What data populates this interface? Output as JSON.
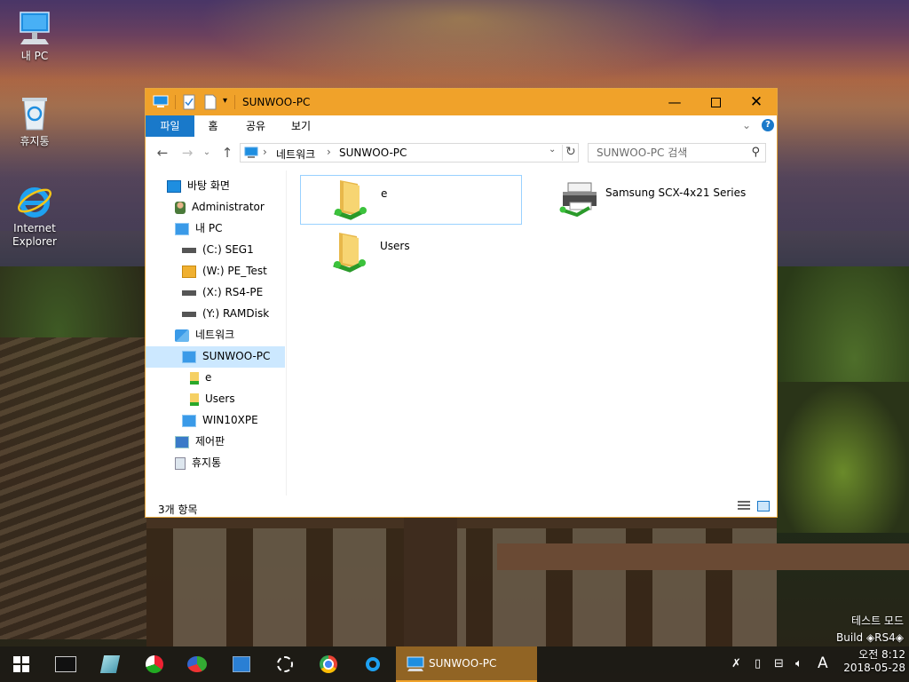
{
  "desktop": {
    "icons": [
      {
        "label": "내 PC"
      },
      {
        "label": "휴지통"
      },
      {
        "label": "Internet Explorer"
      }
    ],
    "watermark": {
      "line1": "테스트 모드",
      "line2": "Build  ◈RS4◈"
    }
  },
  "explorer": {
    "title": "SUNWOO-PC",
    "ribbon_tabs": [
      "파일",
      "홈",
      "공유",
      "보기"
    ],
    "address": {
      "segments": [
        "네트워크",
        "SUNWOO-PC"
      ]
    },
    "search_placeholder": "SUNWOO-PC 검색",
    "nav": [
      {
        "label": "바탕 화면",
        "icon": "desktop-icon"
      },
      {
        "label": "Administrator",
        "icon": "user-icon"
      },
      {
        "label": "내 PC",
        "icon": "computer-icon"
      },
      {
        "label": "(C:) SEG1",
        "icon": "drive-icon"
      },
      {
        "label": "(W:) PE_Test",
        "icon": "drive-folder-icon"
      },
      {
        "label": "(X:) RS4-PE",
        "icon": "drive-icon"
      },
      {
        "label": "(Y:) RAMDisk",
        "icon": "drive-icon"
      },
      {
        "label": "네트워크",
        "icon": "network-icon"
      },
      {
        "label": "SUNWOO-PC",
        "icon": "computer-icon"
      },
      {
        "label": "e",
        "icon": "shared-folder-icon"
      },
      {
        "label": "Users",
        "icon": "shared-folder-icon"
      },
      {
        "label": "WIN10XPE",
        "icon": "computer-icon"
      },
      {
        "label": "제어판",
        "icon": "control-panel-icon"
      },
      {
        "label": "휴지통",
        "icon": "recycle-bin-icon"
      }
    ],
    "items": [
      {
        "label": "e",
        "icon": "shared-folder-icon"
      },
      {
        "label": "Samsung SCX-4x21 Series",
        "icon": "printer-icon"
      },
      {
        "label": "Users",
        "icon": "shared-folder-icon"
      }
    ],
    "status_text": "3개 항목"
  },
  "taskbar": {
    "active_window_label": "SUNWOO-PC",
    "ime_indicator": "A",
    "clock": {
      "time": "오전 8:12",
      "date": "2018-05-28"
    }
  },
  "colors": {
    "titlebar": "#f0a22a",
    "file_tab": "#1979ca",
    "selection": "#cce8ff"
  }
}
